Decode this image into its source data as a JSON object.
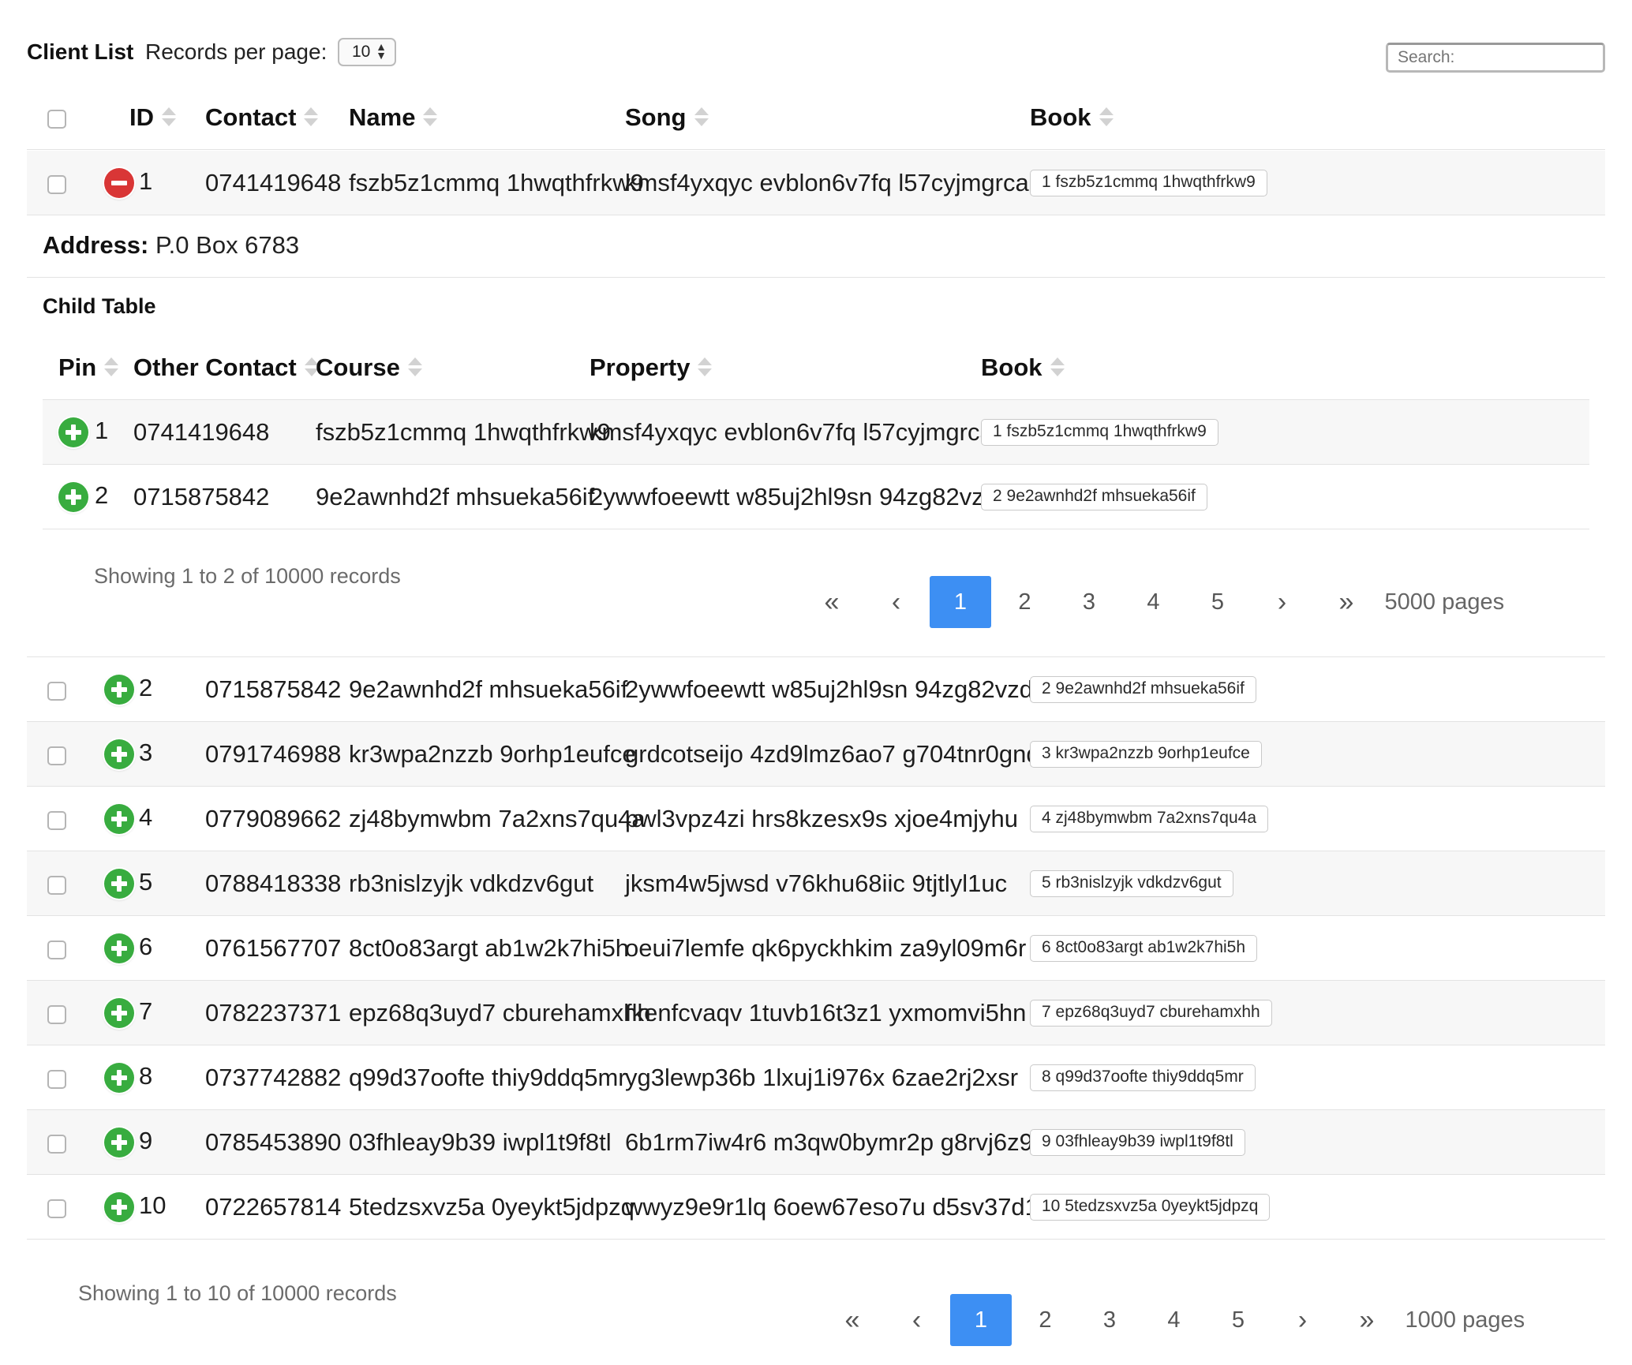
{
  "header": {
    "title": "Client List",
    "rpp_label": "Records per page:",
    "rpp_value": "10",
    "search_placeholder": "Search:"
  },
  "columns": [
    "ID",
    "Contact",
    "Name",
    "Song",
    "Book"
  ],
  "expanded": {
    "address_label": "Address:",
    "address_value": "P.0 Box 6783",
    "child_title": "Child Table",
    "child_columns": [
      "Pin",
      "Other Contact",
      "Course",
      "Property",
      "Book"
    ],
    "child_rows": [
      {
        "pin": "1",
        "contact": "0741419648",
        "course": "fszb5z1cmmq 1hwqthfrkw9",
        "property": "kmsf4yxqyc evblon6v7fq l57cyjmgrca",
        "book": "1 fszb5z1cmmq 1hwqthfrkw9"
      },
      {
        "pin": "2",
        "contact": "0715875842",
        "course": "9e2awnhd2f mhsueka56if",
        "property": "2ywwfoeewtt w85uj2hl9sn 94zg82vzd1j",
        "book": "2 9e2awnhd2f mhsueka56if"
      }
    ],
    "child_info": "Showing 1 to 2 of 10000 records",
    "child_pages": [
      "1",
      "2",
      "3",
      "4",
      "5"
    ],
    "child_active_page": "1",
    "child_pages_total": "5000 pages"
  },
  "rows": [
    {
      "id": "1",
      "contact": "0741419648",
      "name": "fszb5z1cmmq 1hwqthfrkw9",
      "song": "kmsf4yxqyc evblon6v7fq l57cyjmgrca",
      "book": "1 fszb5z1cmmq 1hwqthfrkw9"
    },
    {
      "id": "2",
      "contact": "0715875842",
      "name": "9e2awnhd2f mhsueka56if",
      "song": "2ywwfoeewtt w85uj2hl9sn 94zg82vzd1j",
      "book": "2 9e2awnhd2f mhsueka56if"
    },
    {
      "id": "3",
      "contact": "0791746988",
      "name": "kr3wpa2nzzb 9orhp1eufce",
      "song": "grdcotseijo 4zd9lmz6ao7 g704tnr0gnq",
      "book": "3 kr3wpa2nzzb 9orhp1eufce"
    },
    {
      "id": "4",
      "contact": "0779089662",
      "name": "zj48bymwbm 7a2xns7qu4a",
      "song": "pwl3vpz4zi hrs8kzesx9s xjoe4mjyhu",
      "book": "4 zj48bymwbm 7a2xns7qu4a"
    },
    {
      "id": "5",
      "contact": "0788418338",
      "name": "rb3nislzyjk vdkdzv6gut",
      "song": "jksm4w5jwsd v76khu68iic 9tjtlyl1uc",
      "book": "5 rb3nislzyjk vdkdzv6gut"
    },
    {
      "id": "6",
      "contact": "0761567707",
      "name": "8ct0o83argt ab1w2k7hi5h",
      "song": "oeui7lemfe qk6pyckhkim za9yl09m6r",
      "book": "6 8ct0o83argt ab1w2k7hi5h"
    },
    {
      "id": "7",
      "contact": "0782237371",
      "name": "epz68q3uyd7 cburehamxhh",
      "song": "fkenfcvaqv 1tuvb16t3z1 yxmomvi5hn",
      "book": "7 epz68q3uyd7 cburehamxhh"
    },
    {
      "id": "8",
      "contact": "0737742882",
      "name": "q99d37oofte thiy9ddq5mr",
      "song": "yg3lewp36b 1lxuj1i976x 6zae2rj2xsr",
      "book": "8 q99d37oofte thiy9ddq5mr"
    },
    {
      "id": "9",
      "contact": "0785453890",
      "name": "03fhleay9b39 iwpl1t9f8tl",
      "song": "6b1rm7iw4r6 m3qw0bymr2p g8rvj6z9dwv",
      "book": "9 03fhleay9b39 iwpl1t9f8tl"
    },
    {
      "id": "10",
      "contact": "0722657814",
      "name": "5tedzsxvz5a 0yeykt5jdpzq",
      "song": "wwyz9e9r1lq 6oew67eso7u d5sv37d1u2r",
      "book": "10 5tedzsxvz5a 0yeykt5jdpzq"
    }
  ],
  "footer": {
    "info": "Showing 1 to 10 of 10000 records",
    "pages": [
      "1",
      "2",
      "3",
      "4",
      "5"
    ],
    "active_page": "1",
    "pages_total": "1000 pages"
  },
  "pager_glyphs": {
    "first": "«",
    "prev": "‹",
    "next": "›",
    "last": "»"
  },
  "icons": {
    "expand": "plus-circle-icon",
    "collapse": "minus-circle-icon",
    "sort": "sort-icon"
  },
  "colors": {
    "expand": "#38ac3f",
    "collapse": "#d93636",
    "active_page": "#3d8ff3",
    "stripe": "#f7f7f7"
  }
}
